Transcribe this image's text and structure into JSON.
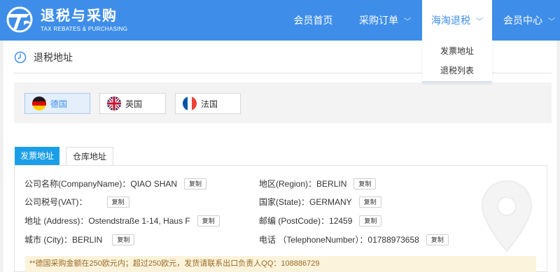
{
  "logo": {
    "name": "退税与采购",
    "tagline": "TAX REBATES & PURCHASING"
  },
  "nav": [
    {
      "label": "会员首页",
      "has_dropdown": false
    },
    {
      "label": "采购订单",
      "has_dropdown": true
    },
    {
      "label": "海淘退税",
      "has_dropdown": true,
      "active": true
    },
    {
      "label": "会员中心",
      "has_dropdown": true
    }
  ],
  "dropdown": {
    "items": [
      "发票地址",
      "退税列表"
    ]
  },
  "section": {
    "title": "退税地址"
  },
  "countries": [
    {
      "label": "德国",
      "flag": "germany",
      "selected": true
    },
    {
      "label": "英国",
      "flag": "uk",
      "selected": false
    },
    {
      "label": "法国",
      "flag": "france",
      "selected": false
    }
  ],
  "tabs": [
    {
      "label": "发票地址",
      "active": true
    },
    {
      "label": "仓库地址",
      "active": false
    }
  ],
  "copy_label": "复制",
  "fields": {
    "company_name": "公司名称(CompanyName)：QIAO SHAN",
    "vat": "公司税号(VAT)：",
    "address": "地址 (Address)：Ostendstraße 1-14, Haus F",
    "city": "城市 (City)：BERLIN",
    "region": "地区(Region)：BERLIN",
    "state": "国家(State)：GERMANY",
    "postcode": "邮编 (PostCode)：12459",
    "phone": "电话 （TelephoneNumber）：01788973658"
  },
  "notice": "**德国采购金额在250欧元内；超过250欧元，发货请联系出口负责人QQ：108886729",
  "colors": {
    "header": "#3e8ee9",
    "tab_active": "#1a9ee8",
    "notice_bg": "#fbf3dc",
    "notice_text": "#9a6a23"
  }
}
